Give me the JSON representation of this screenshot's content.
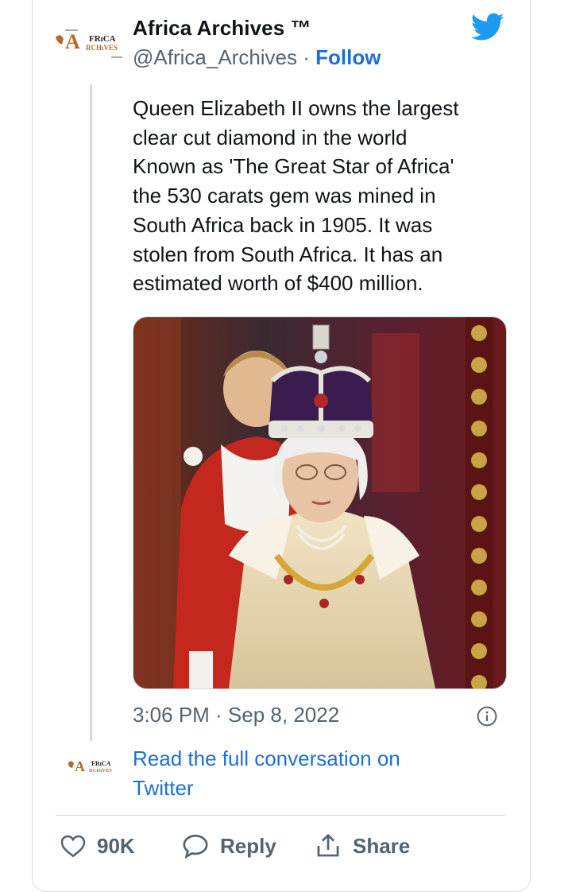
{
  "tweet": {
    "author_name": "Africa Archives ™",
    "handle": "@Africa_Archives",
    "separator": " · ",
    "follow_label": "Follow",
    "avatar_text_top": "FRıCA",
    "avatar_text_a": "A",
    "avatar_text_bottom": "RCHıVES",
    "text": "Queen Elizabeth II owns the largest\nclear cut diamond in the world\nKnown as 'The Great Star of Africa'\nthe 530 carats gem was mined in\nSouth Africa back in 1905. It was\nstolen from South Africa. It has an\nestimated worth of $400 million.",
    "timestamp": "3:06 PM · Sep 8, 2022",
    "read_more": "Read the full conversation on Twitter"
  },
  "actions": {
    "likes_count": "90K",
    "reply_label": "Reply",
    "share_label": "Share"
  },
  "icons": {
    "brand": "twitter-bird-icon",
    "like": "heart-icon",
    "reply": "speech-bubble-icon",
    "share": "share-upload-icon",
    "info": "info-icon"
  },
  "colors": {
    "link": "#1d6fd6",
    "twitter_blue": "#1d9bf0",
    "secondary_text": "#536471",
    "border": "#cfd9de"
  }
}
